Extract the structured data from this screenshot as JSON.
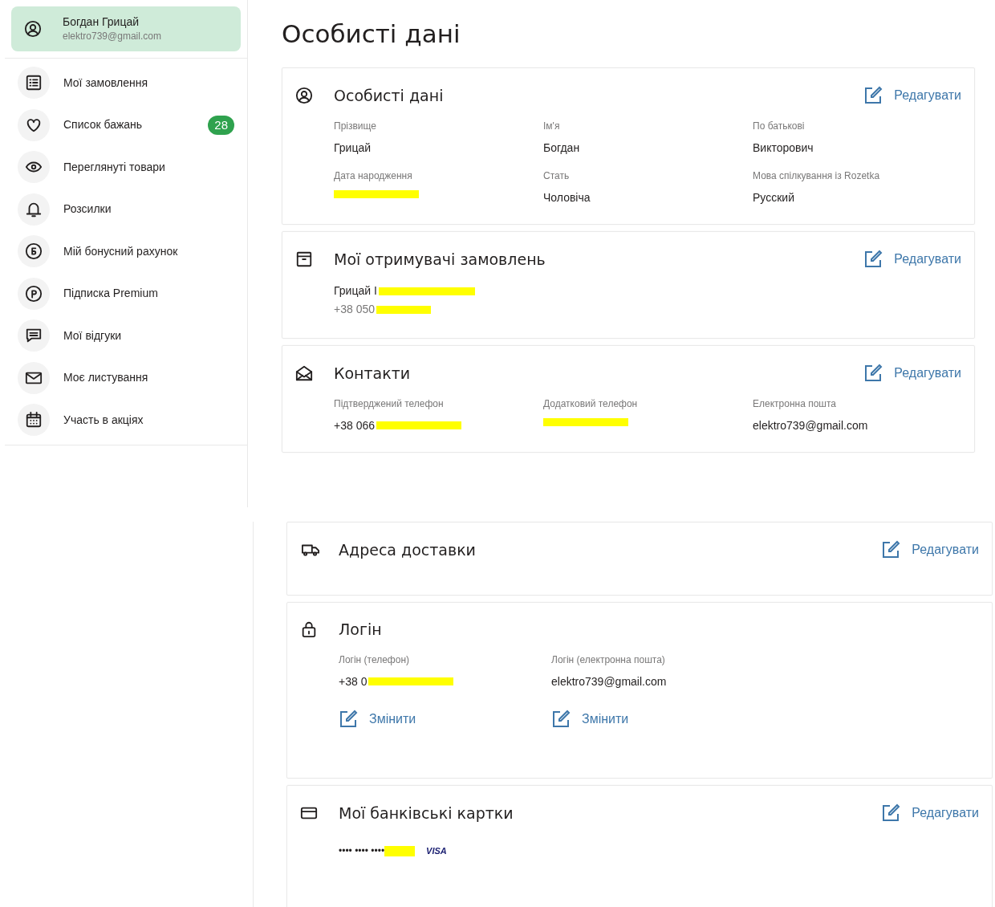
{
  "sidebar": {
    "profile": {
      "name": "Богдан Грицай",
      "email": "elektro739@gmail.com",
      "selected": true
    },
    "items": [
      {
        "label": "Мої замовлення",
        "selected": false
      },
      {
        "label": "Список бажань",
        "badge": "28",
        "selected": false
      },
      {
        "label": "Переглянуті товари",
        "selected": false
      },
      {
        "label": "Розсилки",
        "selected": false
      },
      {
        "label": "Мій бонусний рахунок",
        "selected": false
      },
      {
        "label": "Підписка Premium",
        "selected": false
      },
      {
        "label": "Мої відгуки",
        "selected": false
      },
      {
        "label": "Моє листування",
        "selected": false
      },
      {
        "label": "Участь в акціях",
        "selected": false
      }
    ]
  },
  "page_title": "Особисті дані",
  "sections": [
    {
      "kind": "fields",
      "title": "Особисті дані",
      "edit": "Редагувати",
      "fields": [
        {
          "label": "Прізвище",
          "value": "Грицай",
          "redacted": false
        },
        {
          "label": "Ім'я",
          "value": "Богдан",
          "redacted": false
        },
        {
          "label": "По батькові",
          "value": "Викторович",
          "redacted": false
        },
        {
          "label": "Дата народження",
          "redacted": true
        },
        {
          "label": "Стать",
          "value": "Чоловіча",
          "redacted": false
        },
        {
          "label": "Мова спілкування із Rozetka",
          "value": "Русский",
          "redacted": false
        }
      ]
    },
    {
      "kind": "lines",
      "title": "Мої отримувачі замовлень",
      "edit": "Редагувати",
      "lines": [
        {
          "text": "Грицай І",
          "redacted": true,
          "muted": false
        },
        {
          "text": "+38 050",
          "redacted": true,
          "muted": true
        }
      ]
    },
    {
      "kind": "fields",
      "title": "Контакти",
      "edit": "Редагувати",
      "fields": [
        {
          "label": "Підтверджений телефон",
          "value": "+38 066",
          "redacted": true
        },
        {
          "label": "Додатковий телефон",
          "redacted": true
        },
        {
          "label": "Електронна пошта",
          "value": "elektro739@gmail.com",
          "redacted": false
        }
      ]
    }
  ],
  "continued_sections": [
    {
      "kind": "empty",
      "title": "Адреса доставки",
      "edit": "Редагувати"
    },
    {
      "kind": "login",
      "title": "Логін",
      "fields": [
        {
          "label": "Логін (телефон)",
          "value": "+38 0",
          "redacted": true,
          "action": "Змінити"
        },
        {
          "label": "Логін (електронна пошта)",
          "value": "elektro739@gmail.com",
          "redacted": false,
          "action": "Змінити"
        }
      ]
    },
    {
      "kind": "cards",
      "title": "Мої банківські картки",
      "edit": "Редагувати",
      "cards": [
        {
          "number": "•••• •••• ••••",
          "redacted": true,
          "brand": "VISA"
        }
      ]
    }
  ]
}
